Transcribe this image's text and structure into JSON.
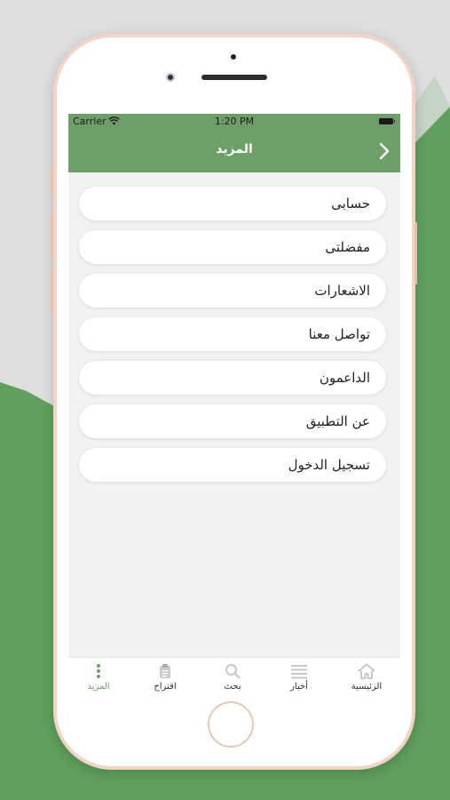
{
  "colors": {
    "brand_green": "#6e9f69",
    "background_green": "#5fa05c",
    "background_gray": "#dedede",
    "phone_frame": "#f3d3c6"
  },
  "status_bar": {
    "carrier": "Carrier",
    "time": "1:20 PM"
  },
  "nav_bar": {
    "title": "المزيد",
    "back_icon": "chevron-icon"
  },
  "menu": {
    "items": [
      {
        "label": "حسابى"
      },
      {
        "label": "مفضلتى"
      },
      {
        "label": "الاشعارات"
      },
      {
        "label": "تواصل معنا"
      },
      {
        "label": "الداعمون"
      },
      {
        "label": "عن التطبيق"
      },
      {
        "label": "تسجيل الدخول"
      }
    ]
  },
  "tab_bar": {
    "active": "more",
    "tabs": [
      {
        "id": "home",
        "label": "الرئيسية",
        "icon": "home-icon"
      },
      {
        "id": "news",
        "label": "أخبار",
        "icon": "list-icon"
      },
      {
        "id": "search",
        "label": "بحث",
        "icon": "search-icon"
      },
      {
        "id": "suggest",
        "label": "اقتراح",
        "icon": "clipboard-icon"
      },
      {
        "id": "more",
        "label": "المزيد",
        "icon": "more-vertical-icon"
      }
    ]
  }
}
